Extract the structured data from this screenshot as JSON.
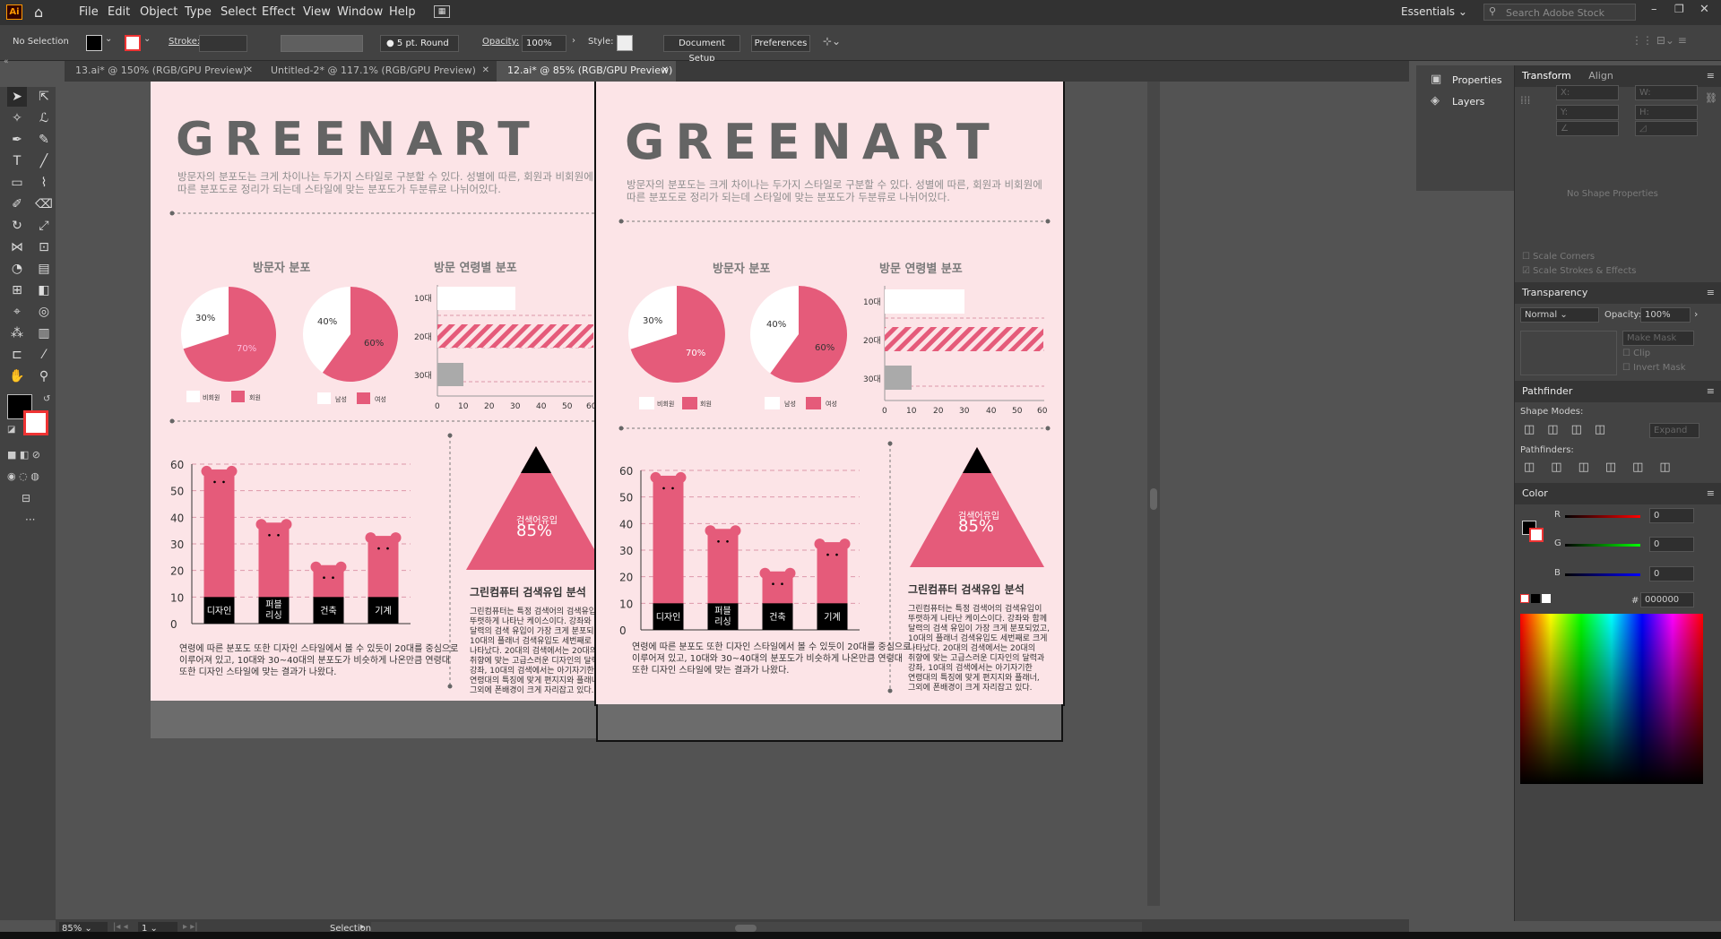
{
  "app": {
    "logo": "Ai"
  },
  "menu": [
    "File",
    "Edit",
    "Object",
    "Type",
    "Select",
    "Effect",
    "View",
    "Window",
    "Help"
  ],
  "workspace": "Essentials",
  "search_placeholder": "Search Adobe Stock",
  "control": {
    "selection": "No Selection",
    "stroke_label": "Stroke:",
    "brush": "5 pt. Round",
    "opacity_label": "Opacity:",
    "opacity_value": "100%",
    "style_label": "Style:",
    "doc_setup": "Document Setup",
    "preferences": "Preferences"
  },
  "tabs": [
    {
      "label": "13.ai* @ 150% (RGB/GPU Preview)"
    },
    {
      "label": "Untitled-2* @ 117.1% (RGB/GPU Preview)"
    },
    {
      "label": "12.ai* @ 85% (RGB/GPU Preview)"
    }
  ],
  "artboard": {
    "title": "GREENART",
    "intro_line1": "방문자의 분포도는 크게 차이나는 두가지 스타일로 구분할 수 있다. 성별에 따른, 회원과 비회원에",
    "intro_line2": "따른 분포도로 정리가 되는데 스타일에 맞는 분포도가 두분류로 나뉘어있다.",
    "pie_heading": "방문자 분포",
    "bar_heading": "방문 연령별 분포",
    "pie1_small": "30%",
    "pie1_big": "70%",
    "pie2_small": "40%",
    "pie2_big": "60%",
    "legend1_a": "비회원",
    "legend1_b": "회원",
    "legend2_a": "남성",
    "legend2_b": "여성",
    "search_label": "검색어유입",
    "search_value": "85%",
    "analysis_heading": "그린컴퓨터 검색유입 분석",
    "analysis_body_1": "그린컴퓨터는 특정 검색어의 검색유입이",
    "analysis_body_2": "뚜렷하게 나타난 케이스이다. 강좌와 함께",
    "analysis_body_3": "달력의 검색 유입이 가장 크게 분포되었고,",
    "analysis_body_4": "10대의 플래너 검색유입도 세번째로 크게",
    "analysis_body_5": "나타났다. 20대의 검색에서는 20대의",
    "analysis_body_6": "취향에 맞는 고급스러운 디자인의 달력과",
    "analysis_body_7": "강좌, 10대의 검색에서는 아기자기한",
    "analysis_body_8": "연령대의 특징에 맞게 편지지와 플래너,",
    "analysis_body_9": "그외에 폰배경이 크게 자리잡고 있다.",
    "bottom_1": "연령에 따른 분포도 또한 디자인 스타일에서 볼 수 있듯이 20대를 중심으로",
    "bottom_2": "이루어져  있고, 10대와 30~40대의 분포도가 비슷하게 나온만큼 연령대",
    "bottom_3": "또한 디자인 스타일에 맞는 결과가 나왔다."
  },
  "chart_data": [
    {
      "type": "pie",
      "series": [
        {
          "name": "비회원",
          "values": [
            30
          ]
        },
        {
          "name": "회원",
          "values": [
            70
          ]
        }
      ]
    },
    {
      "type": "pie",
      "series": [
        {
          "name": "남성",
          "values": [
            40
          ]
        },
        {
          "name": "여성",
          "values": [
            60
          ]
        }
      ]
    },
    {
      "type": "bar",
      "categories": [
        "10대",
        "20대",
        "30대"
      ],
      "values": [
        30,
        60,
        10
      ],
      "xlim": [
        0,
        60
      ],
      "xticks": [
        "0",
        "10",
        "20",
        "30",
        "40",
        "50",
        "60"
      ]
    },
    {
      "type": "bar",
      "categories": [
        "디자인",
        "퍼블리싱",
        "건축",
        "기계"
      ],
      "values": [
        58,
        38,
        22,
        33
      ],
      "ylim": [
        0,
        60
      ],
      "yticks": [
        "0",
        "10",
        "20",
        "30",
        "40",
        "50",
        "60"
      ]
    }
  ],
  "panels": {
    "properties": "Properties",
    "layers": "Layers",
    "transform": "Transform",
    "align": "Align",
    "no_shape": "No Shape Properties",
    "scale_corners": "Scale Corners",
    "scale_strokes": "Scale Strokes & Effects",
    "transparency": "Transparency",
    "blend": "Normal",
    "t_opacity_label": "Opacity:",
    "t_opacity": "100%",
    "make_mask": "Make Mask",
    "clip": "Clip",
    "invert_mask": "Invert Mask",
    "pathfinder": "Pathfinder",
    "shape_modes": "Shape Modes:",
    "expand": "Expand",
    "pathfinders": "Pathfinders:",
    "color": "Color",
    "r": "R",
    "g": "G",
    "b": "B",
    "r_val": "0",
    "g_val": "0",
    "b_val": "0",
    "hex_label": "#",
    "hex": "000000"
  },
  "status": {
    "zoom": "85%",
    "page": "1",
    "tool": "Selection"
  },
  "colors": {
    "pink": "#e55b7a",
    "bg": "#fce4e7",
    "gray": "#646464"
  }
}
